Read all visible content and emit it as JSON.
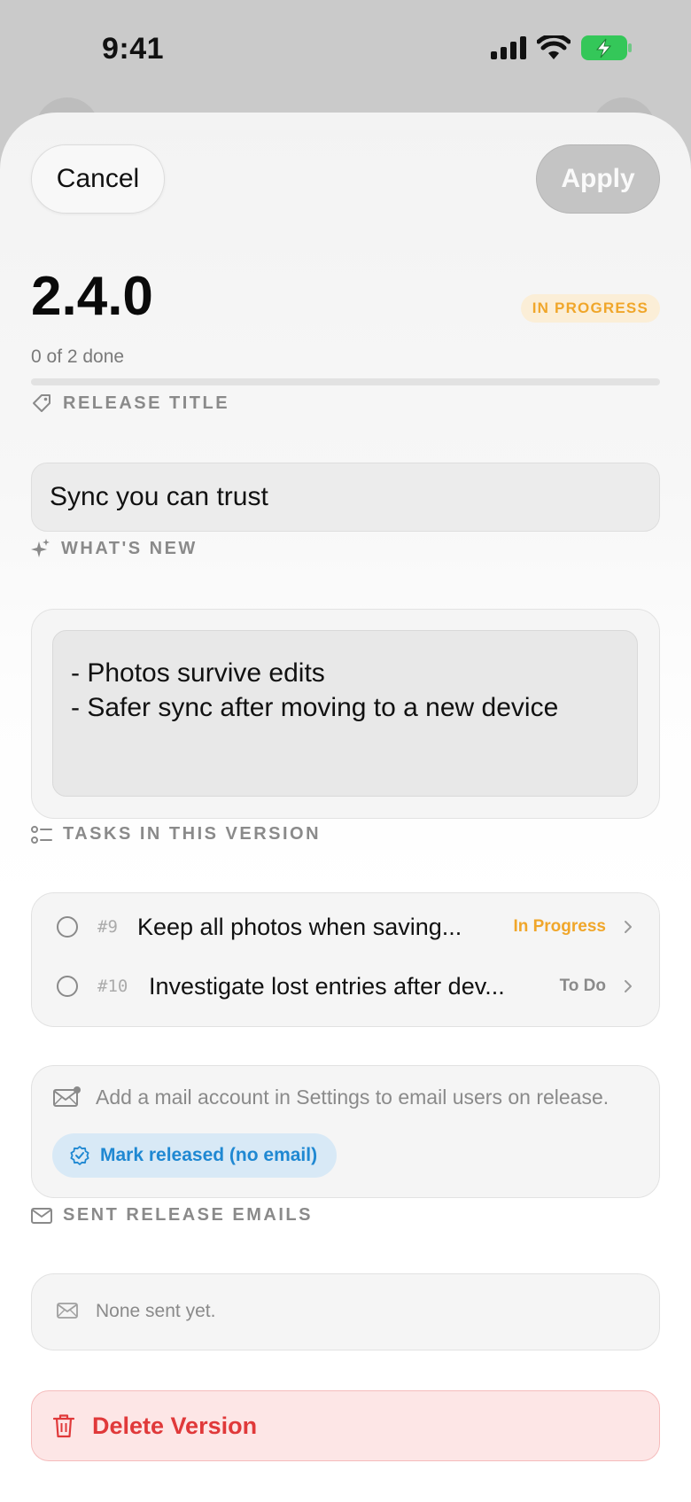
{
  "status_bar": {
    "time": "9:41"
  },
  "header": {
    "cancel_label": "Cancel",
    "apply_label": "Apply"
  },
  "version": {
    "number": "2.4.0",
    "status": "IN PROGRESS",
    "progress_text": "0 of 2 done",
    "progress_fraction": 0
  },
  "release_title": {
    "label": "RELEASE TITLE",
    "value": "Sync you can trust"
  },
  "whats_new": {
    "label": "WHAT'S NEW",
    "line1": "- Photos survive edits",
    "line2": "- Safer sync after moving to a new device"
  },
  "tasks": {
    "label": "TASKS IN THIS VERSION",
    "items": [
      {
        "number": "#9",
        "title": "Keep all photos when saving...",
        "status": "In Progress",
        "status_color": "#f0a62a"
      },
      {
        "number": "#10",
        "title": "Investigate lost entries after dev...",
        "status": "To Do",
        "status_color": "#8a8a8a"
      }
    ]
  },
  "mail": {
    "note": "Add a mail account in Settings to email users on release.",
    "mark_released_label": "Mark released (no email)"
  },
  "sent_emails": {
    "label": "SENT RELEASE EMAILS",
    "empty_text": "None sent yet."
  },
  "delete_label": "Delete Version",
  "colors": {
    "accent_orange": "#f0a62a",
    "accent_blue": "#1f88d2",
    "danger_red": "#e0393a"
  }
}
